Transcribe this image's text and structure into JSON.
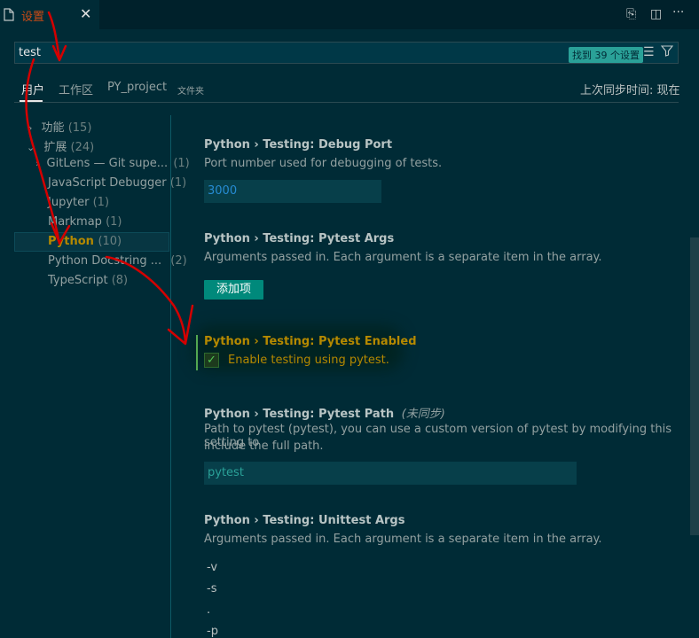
{
  "tab": {
    "title": "设置",
    "close": "✕"
  },
  "editor_actions": {
    "open_json": "⎘",
    "split": "◫",
    "more": "···"
  },
  "search": {
    "value": "test",
    "result_badge": "找到 39 个设置",
    "clear_icon": "☰",
    "filter_icon": "⛛"
  },
  "scopes": {
    "user": "用户",
    "workspace": "工作区",
    "folder": "PY_project",
    "folder_tag": "文件夹"
  },
  "sync_status": "上次同步时间: 现在",
  "toc": [
    {
      "label": "功能",
      "count": "(15)",
      "chevron": "›"
    },
    {
      "label": "扩展",
      "count": "(24)",
      "chevron": "⌄"
    },
    {
      "label": "GitLens — Git supe...",
      "count": "(1)",
      "chevron": "›"
    },
    {
      "label": "JavaScript Debugger",
      "count": "(1)"
    },
    {
      "label": "Jupyter",
      "count": "(1)"
    },
    {
      "label": "Markmap",
      "count": "(1)"
    },
    {
      "label": "Python",
      "count": "(10)"
    },
    {
      "label": "Python Docstring ...",
      "count": "(2)"
    },
    {
      "label": "TypeScript",
      "count": "(8)"
    }
  ],
  "settings": {
    "debug_port": {
      "title": "Python › Testing: Debug Port",
      "desc": "Port number used for debugging of tests.",
      "value": "3000"
    },
    "pytest_args": {
      "title": "Python › Testing: Pytest Args",
      "desc": "Arguments passed in. Each argument is a separate item in the array.",
      "add_button": "添加项"
    },
    "pytest_enabled": {
      "title": "Python › Testing: Pytest Enabled",
      "desc": "Enable testing using pytest.",
      "checked": true,
      "check_glyph": "✓"
    },
    "pytest_path": {
      "title": "Python › Testing: Pytest Path",
      "unsynced": "(未同步)",
      "desc_line1": "Path to pytest (pytest), you can use a custom version of pytest by modifying this setting to",
      "desc_line2": "include the full path.",
      "value": "pytest"
    },
    "unittest_args": {
      "title": "Python › Testing: Unittest Args",
      "desc": "Arguments passed in. Each argument is a separate item in the array.",
      "items": [
        "-v",
        "-s",
        ".",
        "-p"
      ]
    }
  },
  "colors": {
    "background": "#002b36",
    "accent": "#2aa198",
    "modified": "#b58900",
    "annotation": "#d40000"
  }
}
